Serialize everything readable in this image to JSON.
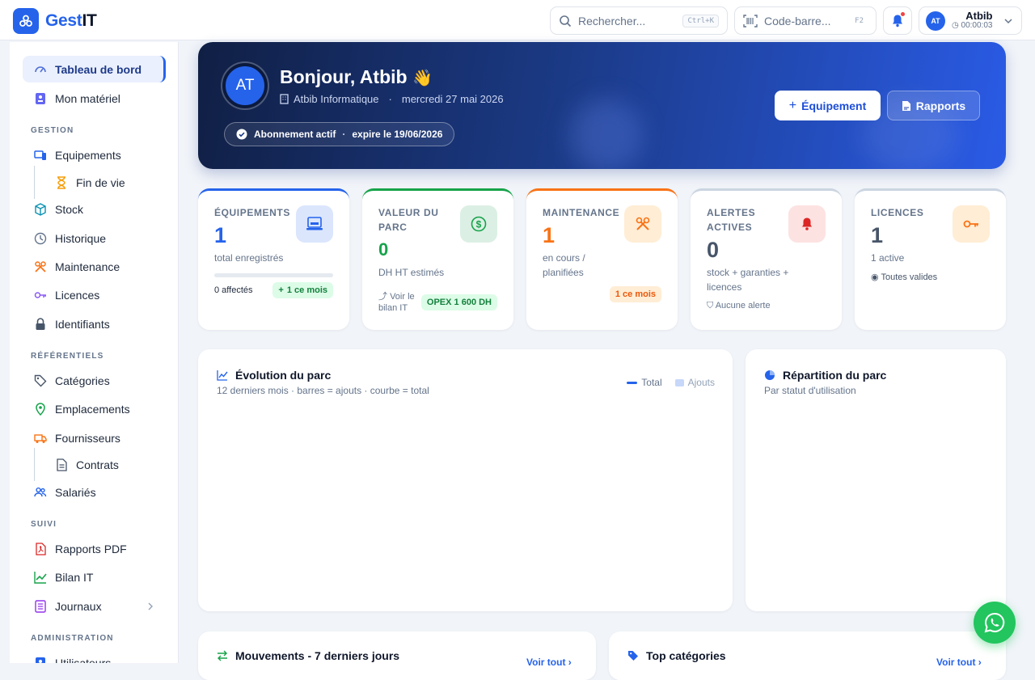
{
  "app": {
    "brand_prefix": "Gest",
    "brand_suffix": "IT"
  },
  "topbar": {
    "search_placeholder": "Rechercher...",
    "search_shortcut": "Ctrl+K",
    "barcode_placeholder": "Code-barre...",
    "barcode_shortcut": "F2",
    "user_initials": "AT",
    "user_name": "Atbib",
    "session_time": "00:00:03"
  },
  "sidebar": {
    "items": [
      {
        "label": "Tableau de bord",
        "icon": "gauge-icon"
      },
      {
        "label": "Mon matériel",
        "icon": "badge-icon"
      },
      {
        "label": "Equipements",
        "icon": "devices-icon"
      },
      {
        "label": "Fin de vie",
        "icon": "hourglass-icon"
      },
      {
        "label": "Stock",
        "icon": "box-icon"
      },
      {
        "label": "Historique",
        "icon": "clock-icon"
      },
      {
        "label": "Maintenance",
        "icon": "tools-icon"
      },
      {
        "label": "Licences",
        "icon": "key-icon"
      },
      {
        "label": "Identifiants",
        "icon": "lock-icon"
      },
      {
        "label": "Catégories",
        "icon": "tag-icon"
      },
      {
        "label": "Emplacements",
        "icon": "pin-icon"
      },
      {
        "label": "Fournisseurs",
        "icon": "truck-icon"
      },
      {
        "label": "Contrats",
        "icon": "document-icon"
      },
      {
        "label": "Salariés",
        "icon": "people-icon"
      },
      {
        "label": "Rapports PDF",
        "icon": "pdf-icon"
      },
      {
        "label": "Bilan IT",
        "icon": "chart-line-icon"
      },
      {
        "label": "Journaux",
        "icon": "list-icon"
      },
      {
        "label": "Utilisateurs",
        "icon": "user-icon"
      }
    ],
    "sections": [
      "GESTION",
      "RÉFÉRENTIELS",
      "SUIVI",
      "ADMINISTRATION"
    ]
  },
  "hero": {
    "initials": "AT",
    "greeting": "Bonjour, Atbib",
    "wave": "👋",
    "company": "Atbib Informatique",
    "separator": "·",
    "date": "mercredi 27 mai 2026",
    "subscription": "Abonnement actif",
    "expiry": "expire le 19/06/2026",
    "btn_equipment": "Équipement",
    "btn_reports": "Rapports"
  },
  "kpis": [
    {
      "label": "ÉQUIPEMENTS",
      "value": "1",
      "sub": "total enregistrés",
      "foot_left": "0 affectés",
      "chip": "1 ce mois",
      "progress": 0
    },
    {
      "label": "VALEUR DU PARC",
      "value": "0",
      "sub": "DH HT estimés",
      "foot_left": "Voir le bilan IT",
      "chip": "OPEX 1 600 DH"
    },
    {
      "label": "MAINTENANCE",
      "value": "1",
      "sub": "en cours / planifiées",
      "chip": "1 ce mois"
    },
    {
      "label": "ALERTES ACTIVES",
      "value": "0",
      "sub": "stock + garanties + licences",
      "foot": "Aucune alerte"
    },
    {
      "label": "LICENCES",
      "value": "1",
      "sub": "1 active",
      "foot": "Toutes valides"
    }
  ],
  "evolution": {
    "title": "Évolution du parc",
    "subtitle": "12 derniers mois · barres = ajouts · courbe = total",
    "legend_total": "Total",
    "legend_ajouts": "Ajouts"
  },
  "repartition": {
    "title": "Répartition du parc",
    "subtitle": "Par statut d'utilisation"
  },
  "mouvements": {
    "title": "Mouvements - 7 derniers jours",
    "see_all": "Voir tout"
  },
  "top": {
    "title": "Top catégories",
    "see_all": "Voir tout"
  },
  "colors": {
    "primary": "#2563eb",
    "green": "#16a34a",
    "orange": "#f97316",
    "red": "#dc2626",
    "slate": "#94a3b8"
  }
}
